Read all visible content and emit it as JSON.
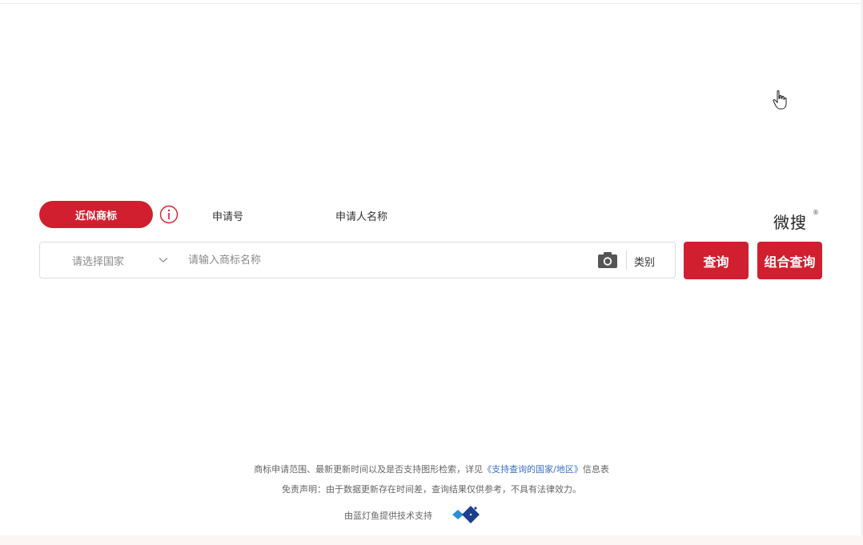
{
  "tabs": {
    "similar_trademark": "近似商标",
    "application_no": "申请号",
    "applicant_name": "申请人名称"
  },
  "brand": {
    "name": "微搜",
    "reg_mark": "®"
  },
  "search": {
    "country_placeholder": "请选择国家",
    "trademark_placeholder": "请输入商标名称",
    "trademark_value": "",
    "class_label": "类别",
    "query_button": "查询",
    "combo_query_button": "组合查询"
  },
  "footer": {
    "line1_prefix": "商标申请范围、最新更新时间以及是否支持图形检索，详见",
    "line1_link": "《支持查询的国家/地区》",
    "line1_suffix": "信息表",
    "disclaimer": "免责声明：由于数据更新存在时间差，查询结果仅供参考，不具有法律效力。",
    "powered_by": "由蓝灯鱼提供技术支持"
  },
  "colors": {
    "accent": "#d21f2f",
    "link": "#3a6fc4"
  },
  "icons": [
    "info-icon",
    "chevron-down-icon",
    "camera-icon",
    "hand-cursor-icon",
    "lanfish-logo"
  ]
}
